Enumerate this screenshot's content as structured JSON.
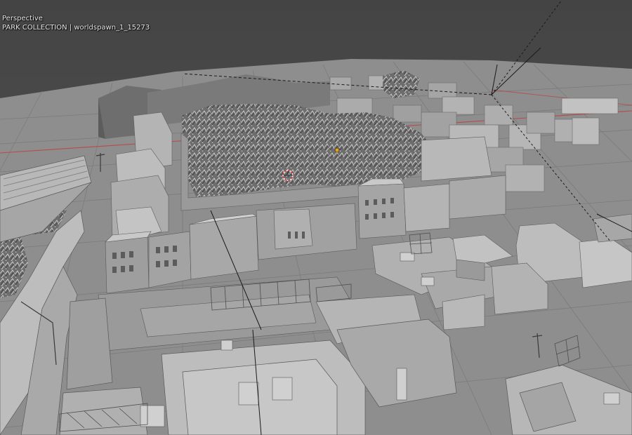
{
  "viewport": {
    "view_mode": "Perspective",
    "object_info": "PARK COLLECTION | worldspawn_1_15273",
    "colors": {
      "sky": "#4b4b4b",
      "ground": "#8f8f8f",
      "grid": "#7d7d7d",
      "x_axis": "#b84a4a",
      "building_top": "#b5b5b5",
      "building_side": "#8c8c8c",
      "foliage": "#6f6f6f"
    }
  }
}
